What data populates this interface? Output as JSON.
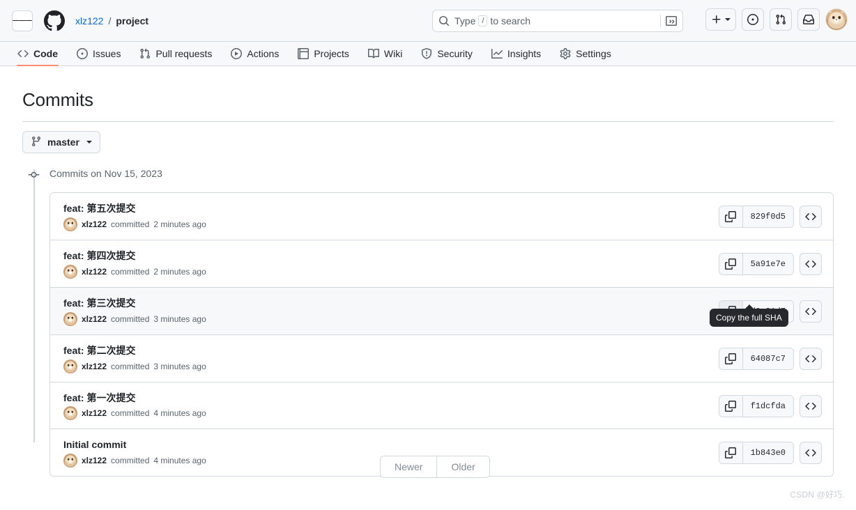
{
  "header": {
    "hamburger_label": "Open navigation menu",
    "logo_icon": "github-mark-icon",
    "owner": "xlz122",
    "separator": "/",
    "repo": "project",
    "search": {
      "icon": "search-icon",
      "placeholder_prefix": "Type",
      "placeholder_key": "/",
      "placeholder_suffix": "to search",
      "terminal_icon": "terminal-icon"
    },
    "actions": [
      {
        "name": "create-new-button",
        "icon": "plus-icon",
        "has_caret": true
      },
      {
        "name": "issues-global-button",
        "icon": "issue-opened-icon"
      },
      {
        "name": "pull-requests-global-button",
        "icon": "git-pull-request-icon"
      },
      {
        "name": "notifications-button",
        "icon": "inbox-icon"
      }
    ],
    "avatar_label": "xlz122"
  },
  "nav": {
    "tabs": [
      {
        "label": "Code",
        "icon": "code-icon",
        "active": true
      },
      {
        "label": "Issues",
        "icon": "issue-opened-icon",
        "active": false
      },
      {
        "label": "Pull requests",
        "icon": "git-pull-request-icon",
        "active": false
      },
      {
        "label": "Actions",
        "icon": "play-icon",
        "active": false
      },
      {
        "label": "Projects",
        "icon": "table-icon",
        "active": false
      },
      {
        "label": "Wiki",
        "icon": "book-icon",
        "active": false
      },
      {
        "label": "Security",
        "icon": "shield-icon",
        "active": false
      },
      {
        "label": "Insights",
        "icon": "graph-icon",
        "active": false
      },
      {
        "label": "Settings",
        "icon": "gear-icon",
        "active": false
      }
    ],
    "active_underline_color": "#fd8c73"
  },
  "main": {
    "page_title": "Commits",
    "branch_selector": {
      "label": "master",
      "icon": "git-branch-icon"
    },
    "group_header": "Commits on Nov 15, 2023",
    "commits": [
      {
        "message": "feat: 第五次提交",
        "author": "xlz122",
        "meta_verb": "committed",
        "time": "2 minutes ago",
        "sha": "829f0d5",
        "hovered": false,
        "copy_active": false
      },
      {
        "message": "feat: 第四次提交",
        "author": "xlz122",
        "meta_verb": "committed",
        "time": "2 minutes ago",
        "sha": "5a91e7e",
        "hovered": false,
        "copy_active": false
      },
      {
        "message": "feat: 第三次提交",
        "author": "xlz122",
        "meta_verb": "committed",
        "time": "3 minutes ago",
        "sha": "d0a21d7",
        "hovered": true,
        "copy_active": true
      },
      {
        "message": "feat: 第二次提交",
        "author": "xlz122",
        "meta_verb": "committed",
        "time": "3 minutes ago",
        "sha": "64087c7",
        "hovered": false,
        "copy_active": false
      },
      {
        "message": "feat: 第一次提交",
        "author": "xlz122",
        "meta_verb": "committed",
        "time": "4 minutes ago",
        "sha": "f1dcfda",
        "hovered": false,
        "copy_active": false
      },
      {
        "message": "Initial commit",
        "author": "xlz122",
        "meta_verb": "committed",
        "time": "4 minutes ago",
        "sha": "1b843e0",
        "hovered": false,
        "copy_active": false
      }
    ],
    "copy_icon_name": "copy-icon",
    "browse_icon_name": "code-icon",
    "tooltip": {
      "text": "Copy the full SHA",
      "visible": true
    },
    "pagination": {
      "newer": "Newer",
      "older": "Older",
      "newer_disabled": true,
      "older_disabled": true
    }
  },
  "watermark": "CSDN @好巧.",
  "colors": {
    "accent_link": "#0969da",
    "active_tab_underline": "#fd8c73",
    "header_bg": "#f6f8fa",
    "border": "#d1d9e0",
    "text": "#1f2328",
    "muted_text": "#59636e",
    "tooltip_bg": "#25292e"
  }
}
